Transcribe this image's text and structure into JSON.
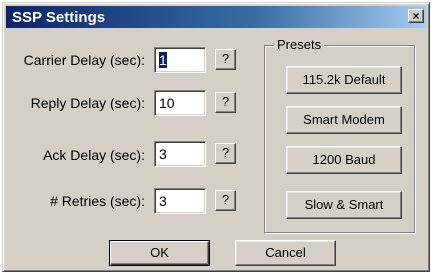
{
  "window": {
    "title": "SSP Settings",
    "close_label": "×"
  },
  "fields": [
    {
      "label": "Carrier Delay (sec):",
      "value": "1",
      "help": "?"
    },
    {
      "label": "Reply Delay (sec):",
      "value": "10",
      "help": "?"
    },
    {
      "label": "Ack Delay (sec):",
      "value": "3",
      "help": "?"
    },
    {
      "label": "# Retries (sec):",
      "value": "3",
      "help": "?"
    }
  ],
  "presets": {
    "label": "Presets",
    "buttons": [
      "115.2k Default",
      "Smart Modem",
      "1200 Baud",
      "Slow & Smart"
    ]
  },
  "actions": {
    "ok": "OK",
    "cancel": "Cancel"
  }
}
